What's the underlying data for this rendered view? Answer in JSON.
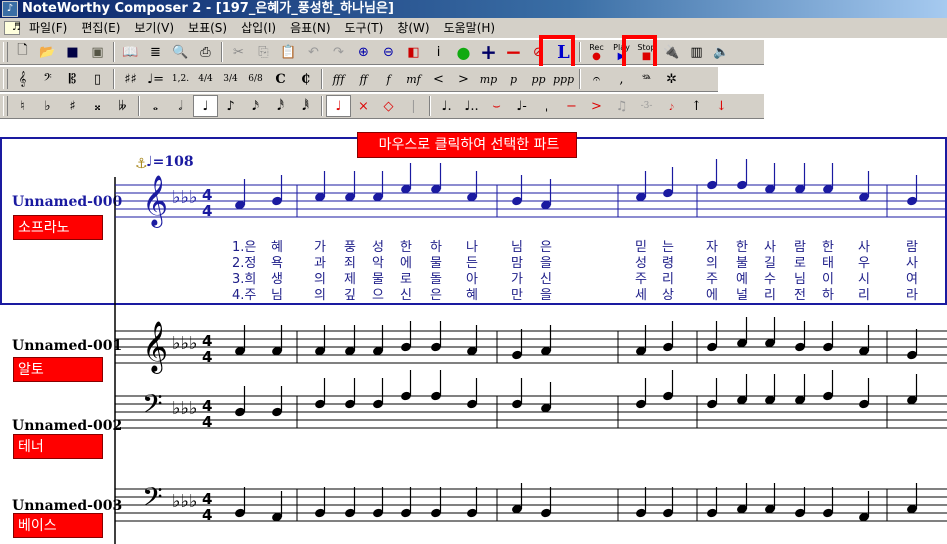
{
  "window": {
    "title": "NoteWorthy Composer 2 - [197_은혜가_풍성한_하나님은]",
    "icon": "nwc-app-icon"
  },
  "menu": [
    "파일(F)",
    "편집(E)",
    "보기(V)",
    "보표(S)",
    "삽입(I)",
    "음표(N)",
    "도구(T)",
    "창(W)",
    "도움말(H)"
  ],
  "toolbar1": [
    "new",
    "open",
    "save",
    "save-all",
    "book",
    "lyrics",
    "preview",
    "print",
    "cut",
    "copy",
    "paste",
    "undo",
    "redo",
    "zoom-in",
    "zoom-out",
    "layers",
    "info",
    "globe",
    "add",
    "remove",
    "mute",
    "L",
    "Rec",
    "Play",
    "Stop",
    "plug",
    "piano",
    "speaker"
  ],
  "toolbar1_labels": {
    "rec": "Rec",
    "play": "Play",
    "stop": "Stop",
    "l": "L"
  },
  "toolbar2": {
    "dyn": [
      "fff",
      "ff",
      "f",
      "mf",
      "mp",
      "p",
      "pp",
      "ppp"
    ],
    "time": [
      "4/4",
      "3/4",
      "6/8"
    ]
  },
  "annotation": "마우스로 클릭하여 선택한 파트",
  "tempo": "=108",
  "staves": [
    {
      "name": "Unnamed-000",
      "part": "소프라노"
    },
    {
      "name": "Unnamed-001",
      "part": "알토"
    },
    {
      "name": "Unnamed-002",
      "part": "테너"
    },
    {
      "name": "Unnamed-003",
      "part": "베이스"
    }
  ],
  "lyrics": {
    "verse1": [
      "1.은",
      "혜",
      "가",
      "풍",
      "성",
      "한",
      "하",
      "나",
      "님",
      "은",
      "믿",
      "는",
      "자",
      "한",
      "사",
      "람",
      "한",
      "사",
      "람"
    ],
    "verse2": [
      "2.정",
      "욕",
      "과",
      "죄",
      "악",
      "에",
      "물",
      "든",
      "맘",
      "을",
      "성",
      "령",
      "의",
      "불",
      "길",
      "로",
      "태",
      "우",
      "사"
    ],
    "verse3": [
      "3.희",
      "생",
      "의",
      "제",
      "물",
      "로",
      "돌",
      "아",
      "가",
      "신",
      "주",
      "리",
      "주",
      "예",
      "수",
      "님",
      "이",
      "시",
      "여"
    ],
    "verse4": [
      "4.주",
      "님",
      "의",
      "깊",
      "으",
      "신",
      "은",
      "혜",
      "만",
      "을",
      "세",
      "상",
      "에",
      "널",
      "리",
      "전",
      "하",
      "리",
      "라"
    ]
  },
  "colors": {
    "accent": "#ff0000",
    "selected_staff": "#1a1aa0"
  }
}
